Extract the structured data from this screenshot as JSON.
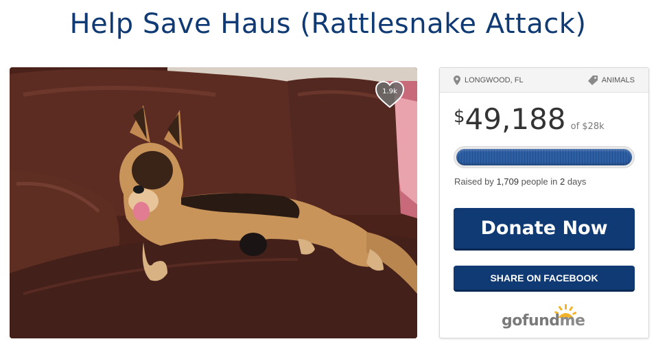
{
  "campaign": {
    "title": "Help Save Haus (Rattlesnake Attack)",
    "location": "LONGWOOD, FL",
    "category": "ANIMALS",
    "hearts": "1.9k"
  },
  "funding": {
    "currency_symbol": "$",
    "raised": "49,188",
    "goal_text": "of $28k",
    "progress_fraction": 1.0,
    "raised_prefix": "Raised by",
    "donors": "1,709",
    "donors_suffix": "people in",
    "days": "2",
    "days_suffix": "days"
  },
  "actions": {
    "donate_label": "Donate Now",
    "share_label": "SHARE ON FACEBOOK"
  },
  "brand": {
    "logo_go": "go",
    "logo_fund": "fund",
    "logo_me": "me",
    "accent": "#0f3a73",
    "sun": "#f2b32a"
  },
  "icons": {
    "location": "map-pin-icon",
    "category": "tag-icon",
    "heart": "heart-icon"
  }
}
